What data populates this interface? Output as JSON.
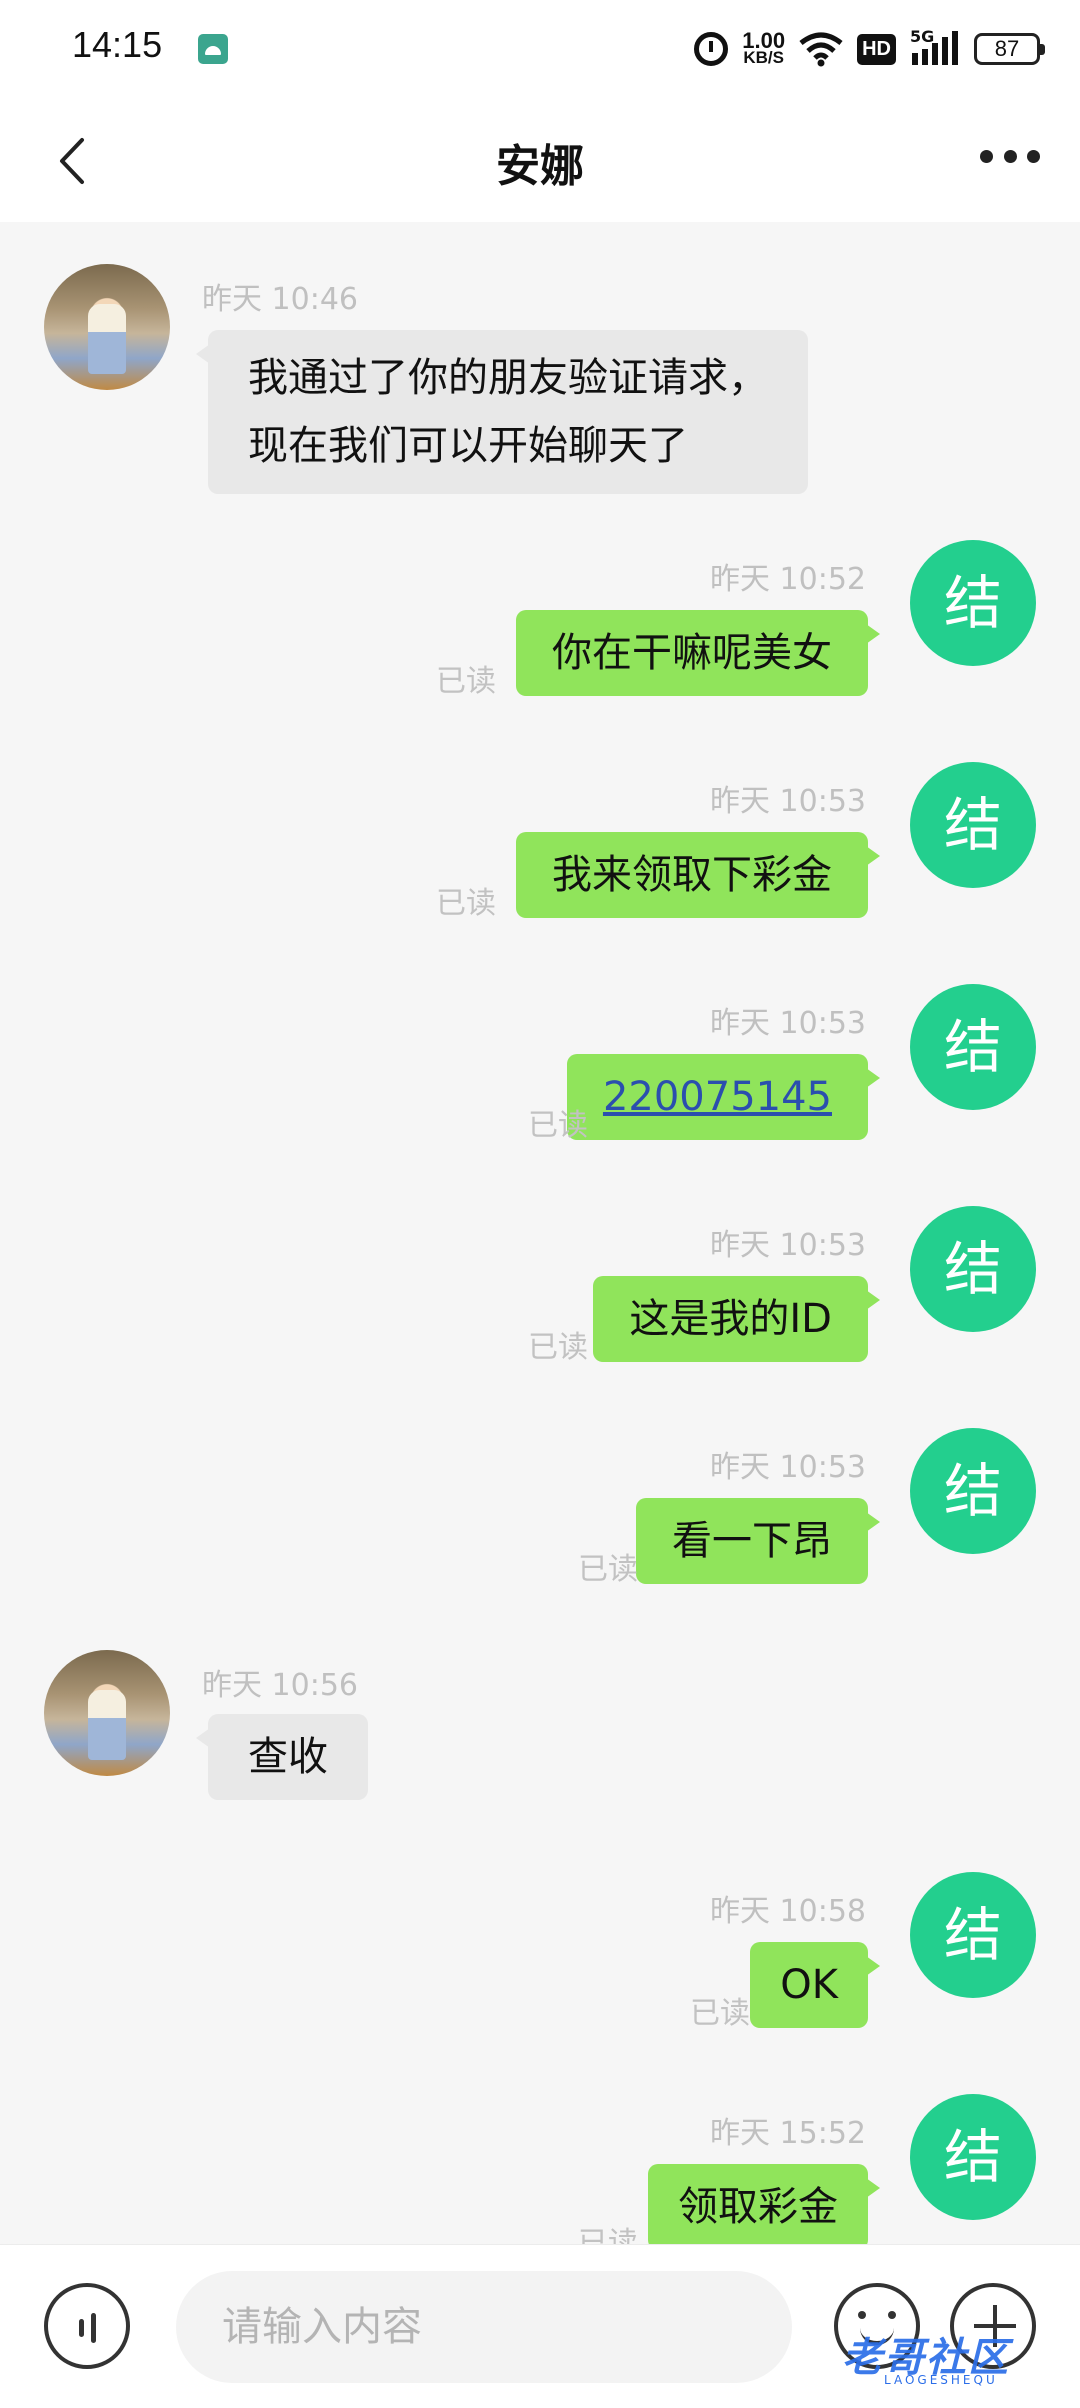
{
  "status_bar": {
    "time": "14:15",
    "net_speed_value": "1.00",
    "net_speed_unit": "KB/S",
    "hd": "HD",
    "signal_label": "5G",
    "battery": "87"
  },
  "header": {
    "title": "安娜"
  },
  "messages": [
    {
      "side": "left",
      "time": "昨天  10:46",
      "lines": [
        "我通过了你的朋友验证请求，",
        "现在我们可以开始聊天了"
      ]
    },
    {
      "side": "right",
      "time": "昨天  10:52",
      "text": "你在干嘛呢美女",
      "read": "已读",
      "avatar_char": "结"
    },
    {
      "side": "right",
      "time": "昨天  10:53",
      "text": "我来领取下彩金",
      "read": "已读",
      "avatar_char": "结"
    },
    {
      "side": "right",
      "time": "昨天  10:53",
      "text": "220075145",
      "read": "已读",
      "avatar_char": "结"
    },
    {
      "side": "right",
      "time": "昨天  10:53",
      "text": "这是我的ID",
      "read": "已读",
      "avatar_char": "结"
    },
    {
      "side": "right",
      "time": "昨天  10:53",
      "text": "看一下昂",
      "read": "已读",
      "avatar_char": "结"
    },
    {
      "side": "left",
      "time": "昨天  10:56",
      "text": "查收"
    },
    {
      "side": "right",
      "time": "昨天  10:58",
      "text": "OK",
      "read": "已读",
      "avatar_char": "结"
    },
    {
      "side": "right",
      "time": "昨天  15:52",
      "text": "领取彩金",
      "read": "已读",
      "avatar_char": "结"
    }
  ],
  "input": {
    "placeholder": "请输入内容"
  },
  "watermark": {
    "text": "老哥社区",
    "sub": "LAOGESHEQU"
  },
  "colors": {
    "own_bubble": "#90e45b",
    "other_bubble": "#e8e8e8",
    "own_avatar": "#23cf8e",
    "link": "#2b4fae"
  }
}
